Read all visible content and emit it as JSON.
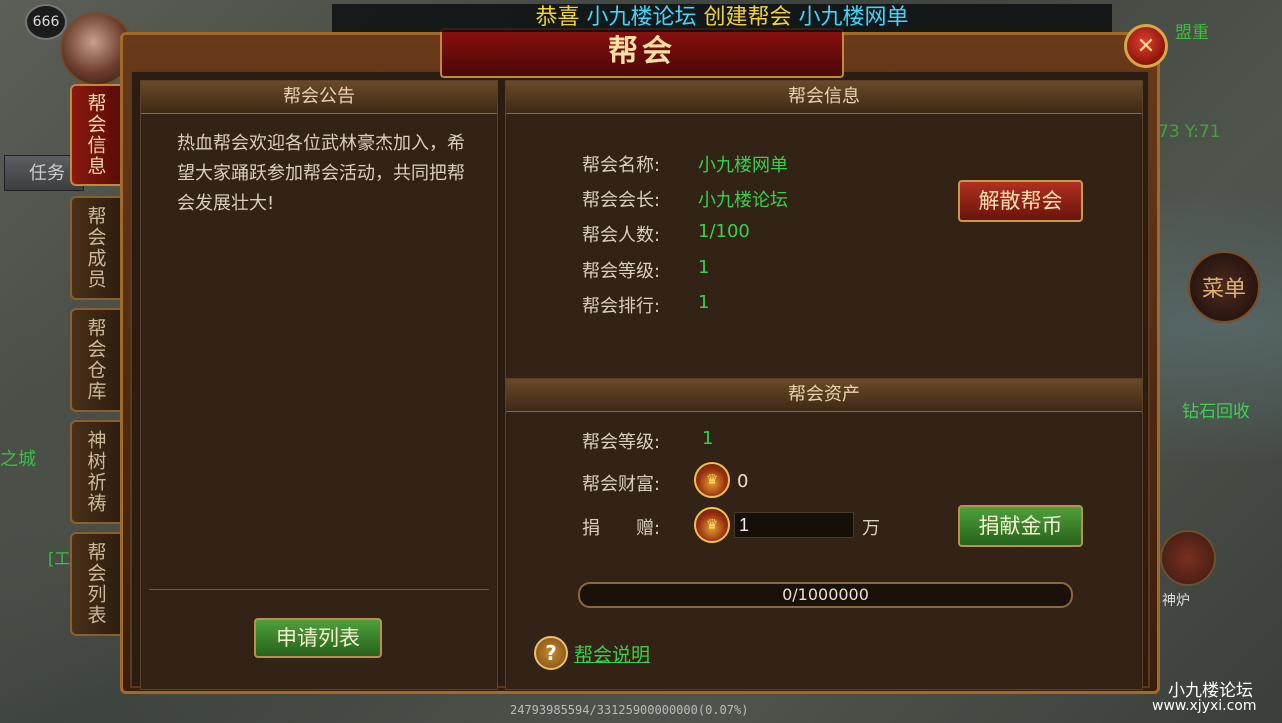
{
  "hud": {
    "level": "666",
    "task_label": "任务",
    "broadcast": {
      "prefix": "恭喜 ",
      "founder": "小九楼论坛",
      "middle": " 创建帮会 ",
      "guild": "小九楼网单"
    },
    "minimap_label": "盟重",
    "coords": "73 Y:71",
    "menu_label": "菜单",
    "diamond_label": "钻石回收",
    "shenlu_label": "神炉",
    "world_text_left": "之城",
    "world_text_left2": "[工",
    "exp_text": "24793985594/33125900000000(0.07%)",
    "watermark_cn": "小九楼论坛",
    "watermark_url": "www.xjyxi.com"
  },
  "dialog": {
    "title": "帮会",
    "close_icon": "close-x-icon",
    "tabs": [
      {
        "label": "帮会信息",
        "active": true
      },
      {
        "label": "帮会成员",
        "active": false
      },
      {
        "label": "帮会仓库",
        "active": false
      },
      {
        "label": "神树祈祷",
        "active": false
      },
      {
        "label": "帮会列表",
        "active": false
      }
    ]
  },
  "notice": {
    "header": "帮会公告",
    "text": "热血帮会欢迎各位武林豪杰加入，希望大家踊跃参加帮会活动，共同把帮会发展壮大!",
    "apply_button": "申请列表"
  },
  "info": {
    "header": "帮会信息",
    "rows": [
      {
        "label": "帮会名称:",
        "value": "小九楼网单"
      },
      {
        "label": "帮会会长:",
        "value": "小九楼论坛"
      },
      {
        "label": "帮会人数:",
        "value": "1/100"
      },
      {
        "label": "帮会等级:",
        "value": "1"
      },
      {
        "label": "帮会排行:",
        "value": "1"
      }
    ],
    "disband_button": "解散帮会"
  },
  "assets": {
    "header": "帮会资产",
    "level_label": "帮会等级:",
    "level_value": "1",
    "wealth_label": "帮会财富:",
    "wealth_value": "0",
    "donate_label": "捐　　赠:",
    "donate_value": "1",
    "donate_unit": "万",
    "donate_button": "捐献金币",
    "progress_text": "0/1000000",
    "progress_fraction": 0,
    "help_link": "帮会说明"
  }
}
